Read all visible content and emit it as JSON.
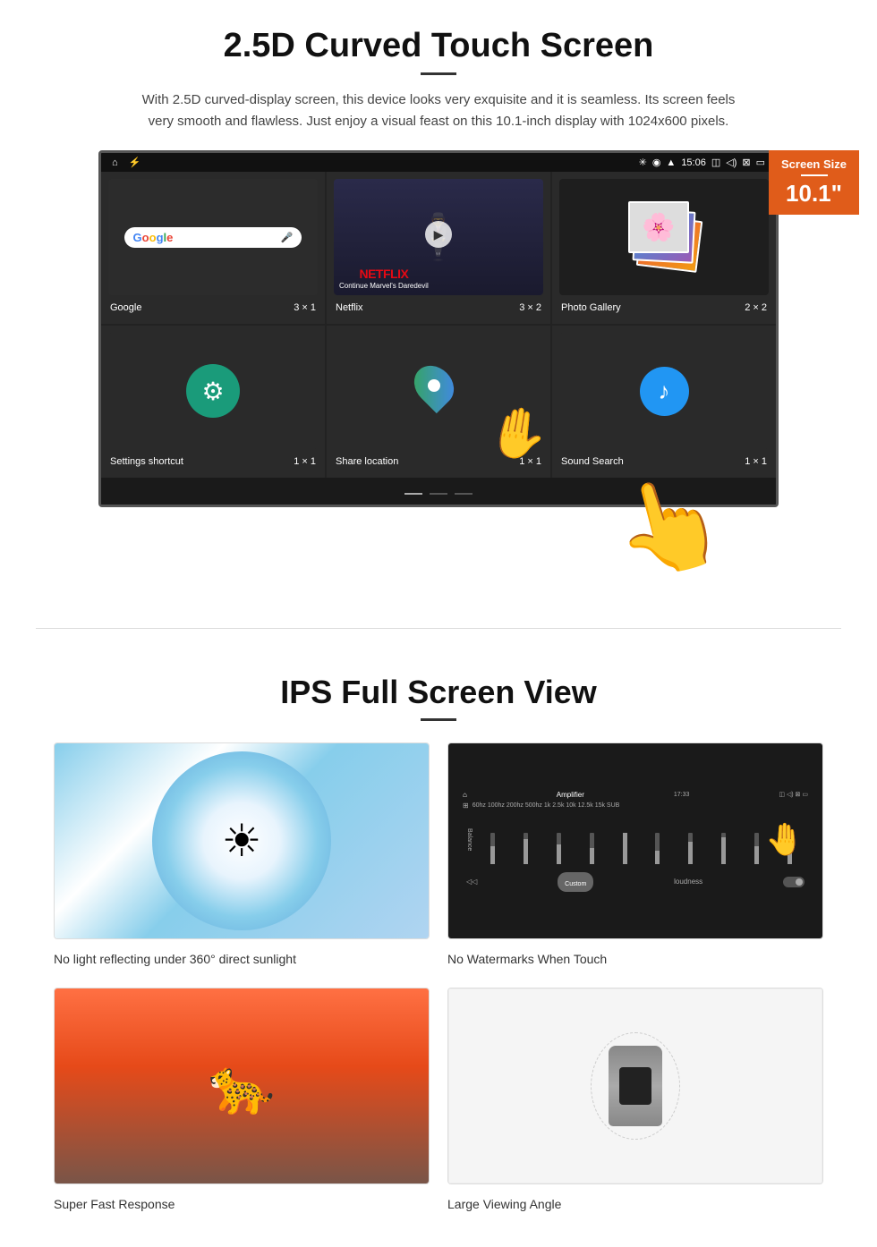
{
  "section1": {
    "title": "2.5D Curved Touch Screen",
    "description": "With 2.5D curved-display screen, this device looks very exquisite and it is seamless. Its screen feels very smooth and flawless. Just enjoy a visual feast on this 10.1-inch display with 1024x600 pixels.",
    "screen_badge": {
      "title": "Screen Size",
      "size": "10.1\""
    },
    "status_bar": {
      "time": "15:06"
    },
    "apps": [
      {
        "name": "Google",
        "grid": "3 × 1"
      },
      {
        "name": "Netflix",
        "grid": "3 × 2",
        "netflix_text": "NETFLIX",
        "netflix_sub": "Continue Marvel's Daredevil"
      },
      {
        "name": "Photo Gallery",
        "grid": "2 × 2"
      },
      {
        "name": "Settings shortcut",
        "grid": "1 × 1"
      },
      {
        "name": "Share location",
        "grid": "1 × 1"
      },
      {
        "name": "Sound Search",
        "grid": "1 × 1"
      }
    ]
  },
  "section2": {
    "title": "IPS Full Screen View",
    "features": [
      {
        "label": "No light reflecting under 360° direct sunlight"
      },
      {
        "label": "No Watermarks When Touch"
      },
      {
        "label": "Super Fast Response"
      },
      {
        "label": "Large Viewing Angle"
      }
    ]
  }
}
